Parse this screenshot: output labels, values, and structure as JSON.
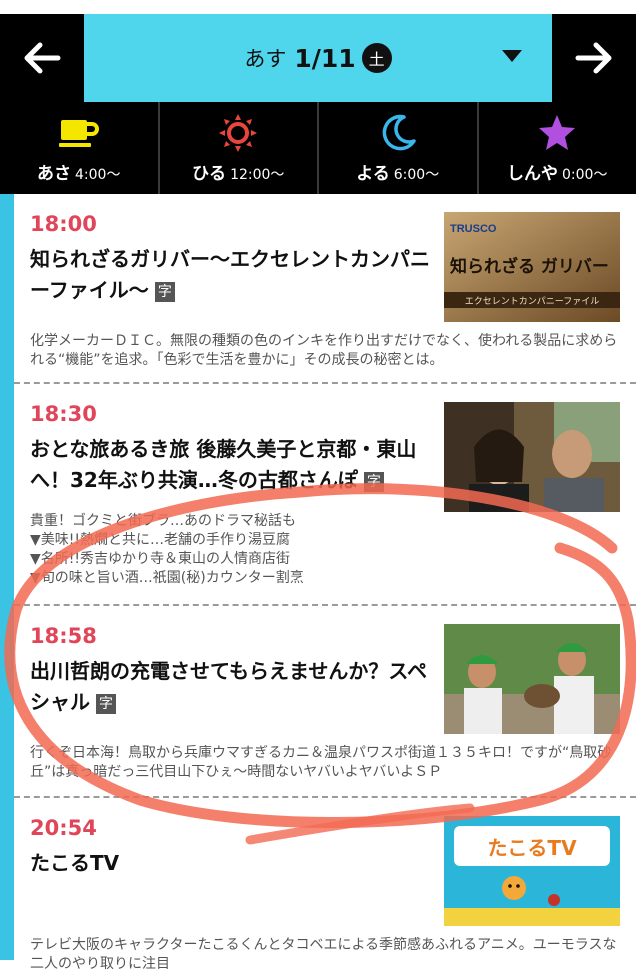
{
  "header": {
    "back_icon": "arrow-left-icon",
    "forward_icon": "arrow-right-icon",
    "date_prefix": "あす",
    "date": "1/11",
    "day_of_week": "土",
    "dropdown_icon": "caret-down-icon",
    "accent_color": "#4fd6ec"
  },
  "time_of_day": [
    {
      "label": "あさ",
      "time": "4:00〜",
      "icon": "coffee-cup-icon",
      "color": "#f5e600"
    },
    {
      "label": "ひる",
      "time": "12:00〜",
      "icon": "sun-icon",
      "color": "#e8463c"
    },
    {
      "label": "よる",
      "time": "6:00〜",
      "icon": "moon-icon",
      "color": "#3ab6ea"
    },
    {
      "label": "しんや",
      "time": "0:00〜",
      "icon": "star-icon",
      "color": "#b04fe0"
    }
  ],
  "programs": [
    {
      "time": "18:00",
      "title": "知られざるガリバー〜エクセレントカンパニーファイル〜",
      "badge": "字",
      "thumb_text": {
        "brand": "TRUSCO",
        "main": "知られざる ガリバー",
        "sub": "エクセレントカンパニーファイル"
      },
      "description": [
        "化学メーカーＤＩＣ。無限の種類の色のインキを作り出すだけでなく、使われる製品に求められる“機能”を追求。「色彩で生活を豊かに」その成長の秘密とは。"
      ]
    },
    {
      "time": "18:30",
      "title": "おとな旅あるき旅 後藤久美子と京都・東山へ！32年ぶり共演…冬の古都さんぽ",
      "badge": "字",
      "description": [
        "貴重！ゴクミと街ブラ…あのドラマ秘話も",
        "▼美味!!熱燗と共に…老舗の手作り湯豆腐",
        "▼名所!!秀吉ゆかり寺＆東山の人情商店街",
        "▼旬の味と旨い酒…祇園(秘)カウンター割烹"
      ]
    },
    {
      "time": "18:58",
      "title": "出川哲朗の充電させてもらえませんか？スペシャル",
      "badge": "字",
      "description": [
        "行くぞ日本海！鳥取から兵庫ウマすぎるカニ＆温泉パワスポ街道１３５キロ！ですが“鳥取砂丘”は真っ暗だっ三代目山下ひぇ〜時間ないヤバいよヤバいよＳＰ"
      ]
    },
    {
      "time": "20:54",
      "title": "たこるTV",
      "badge": "",
      "thumb_text": {
        "main": "たこるTV"
      },
      "description": [
        "テレビ大阪のキャラクターたこるくんとタコベエによる季節感あふれるアニメ。ユーモラスな二人のやり取りに注目"
      ]
    }
  ]
}
